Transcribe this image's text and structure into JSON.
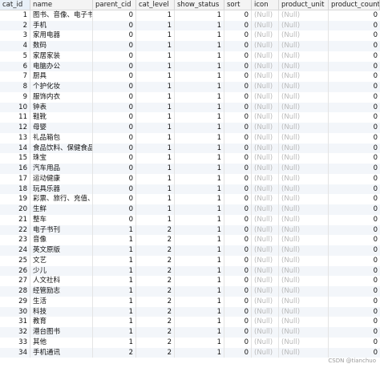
{
  "table": {
    "columns": [
      "cat_id",
      "name",
      "parent_cid",
      "cat_level",
      "show_status",
      "sort",
      "icon",
      "product_unit",
      "product_count"
    ],
    "rows": [
      [
        "1",
        "图书、音像、电子书刊",
        "0",
        "1",
        "1",
        "0",
        "(Null)",
        "(Null)",
        "0"
      ],
      [
        "2",
        "手机",
        "0",
        "1",
        "1",
        "0",
        "(Null)",
        "(Null)",
        "0"
      ],
      [
        "3",
        "家用电器",
        "0",
        "1",
        "1",
        "0",
        "(Null)",
        "(Null)",
        "0"
      ],
      [
        "4",
        "数码",
        "0",
        "1",
        "1",
        "0",
        "(Null)",
        "(Null)",
        "0"
      ],
      [
        "5",
        "家居家装",
        "0",
        "1",
        "1",
        "0",
        "(Null)",
        "(Null)",
        "0"
      ],
      [
        "6",
        "电脑办公",
        "0",
        "1",
        "1",
        "0",
        "(Null)",
        "(Null)",
        "0"
      ],
      [
        "7",
        "厨具",
        "0",
        "1",
        "1",
        "0",
        "(Null)",
        "(Null)",
        "0"
      ],
      [
        "8",
        "个护化妆",
        "0",
        "1",
        "1",
        "0",
        "(Null)",
        "(Null)",
        "0"
      ],
      [
        "9",
        "服饰内衣",
        "0",
        "1",
        "1",
        "0",
        "(Null)",
        "(Null)",
        "0"
      ],
      [
        "10",
        "钟表",
        "0",
        "1",
        "1",
        "0",
        "(Null)",
        "(Null)",
        "0"
      ],
      [
        "11",
        "鞋靴",
        "0",
        "1",
        "1",
        "0",
        "(Null)",
        "(Null)",
        "0"
      ],
      [
        "12",
        "母婴",
        "0",
        "1",
        "1",
        "0",
        "(Null)",
        "(Null)",
        "0"
      ],
      [
        "13",
        "礼品箱包",
        "0",
        "1",
        "1",
        "0",
        "(Null)",
        "(Null)",
        "0"
      ],
      [
        "14",
        "食品饮料、保健食品",
        "0",
        "1",
        "1",
        "0",
        "(Null)",
        "(Null)",
        "0"
      ],
      [
        "15",
        "珠宝",
        "0",
        "1",
        "1",
        "0",
        "(Null)",
        "(Null)",
        "0"
      ],
      [
        "16",
        "汽车用品",
        "0",
        "1",
        "1",
        "0",
        "(Null)",
        "(Null)",
        "0"
      ],
      [
        "17",
        "运动健康",
        "0",
        "1",
        "1",
        "0",
        "(Null)",
        "(Null)",
        "0"
      ],
      [
        "18",
        "玩具乐器",
        "0",
        "1",
        "1",
        "0",
        "(Null)",
        "(Null)",
        "0"
      ],
      [
        "19",
        "彩票、旅行、充值、票务",
        "0",
        "1",
        "1",
        "0",
        "(Null)",
        "(Null)",
        "0"
      ],
      [
        "20",
        "生鲜",
        "0",
        "1",
        "1",
        "0",
        "(Null)",
        "(Null)",
        "0"
      ],
      [
        "21",
        "整车",
        "0",
        "1",
        "1",
        "0",
        "(Null)",
        "(Null)",
        "0"
      ],
      [
        "22",
        "电子书刊",
        "1",
        "2",
        "1",
        "0",
        "(Null)",
        "(Null)",
        "0"
      ],
      [
        "23",
        "音像",
        "1",
        "2",
        "1",
        "0",
        "(Null)",
        "(Null)",
        "0"
      ],
      [
        "24",
        "英文原版",
        "1",
        "2",
        "1",
        "0",
        "(Null)",
        "(Null)",
        "0"
      ],
      [
        "25",
        "文艺",
        "1",
        "2",
        "1",
        "0",
        "(Null)",
        "(Null)",
        "0"
      ],
      [
        "26",
        "少儿",
        "1",
        "2",
        "1",
        "0",
        "(Null)",
        "(Null)",
        "0"
      ],
      [
        "27",
        "人文社科",
        "1",
        "2",
        "1",
        "0",
        "(Null)",
        "(Null)",
        "0"
      ],
      [
        "28",
        "经管励志",
        "1",
        "2",
        "1",
        "0",
        "(Null)",
        "(Null)",
        "0"
      ],
      [
        "29",
        "生活",
        "1",
        "2",
        "1",
        "0",
        "(Null)",
        "(Null)",
        "0"
      ],
      [
        "30",
        "科技",
        "1",
        "2",
        "1",
        "0",
        "(Null)",
        "(Null)",
        "0"
      ],
      [
        "31",
        "教育",
        "1",
        "2",
        "1",
        "0",
        "(Null)",
        "(Null)",
        "0"
      ],
      [
        "32",
        "港台图书",
        "1",
        "2",
        "1",
        "0",
        "(Null)",
        "(Null)",
        "0"
      ],
      [
        "33",
        "其他",
        "1",
        "2",
        "1",
        "0",
        "(Null)",
        "(Null)",
        "0"
      ],
      [
        "34",
        "手机通讯",
        "2",
        "2",
        "1",
        "0",
        "(Null)",
        "(Null)",
        "0"
      ]
    ]
  },
  "watermark": "CSDN @tianchuo",
  "colors": {
    "header_bg": "#f4f4f4",
    "alt_row_bg": "#f3f6fa",
    "null_text": "#b9b9b9"
  }
}
